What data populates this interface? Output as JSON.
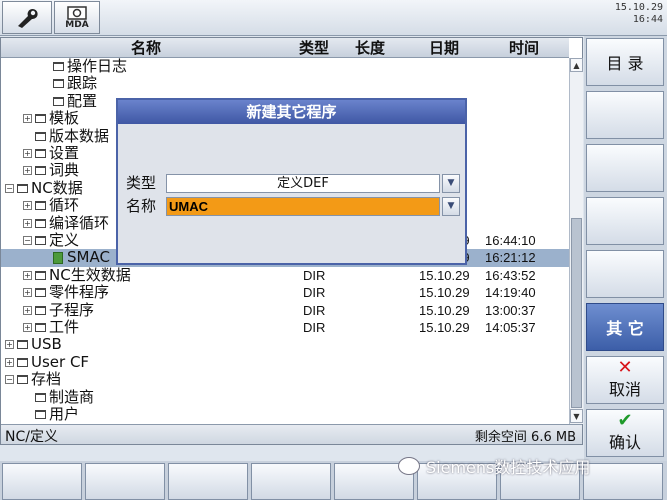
{
  "header": {
    "mda_label": "MDA",
    "date": "15.10.29",
    "time": "16:44"
  },
  "browser": {
    "columns": {
      "name": "名称",
      "type": "类型",
      "length": "长度",
      "date": "日期",
      "time": "时间"
    },
    "rows": [
      {
        "indent": 2,
        "exp": "",
        "icon": "folder",
        "name": "操作日志",
        "type": "",
        "date": "",
        "time": ""
      },
      {
        "indent": 2,
        "exp": "",
        "icon": "folder",
        "name": "跟踪",
        "type": "",
        "date": "",
        "time": ""
      },
      {
        "indent": 2,
        "exp": "",
        "icon": "folder",
        "name": "配置",
        "type": "",
        "date": "",
        "time": ""
      },
      {
        "indent": 1,
        "exp": "+",
        "icon": "folder",
        "name": "模板",
        "type": "",
        "date": "",
        "time": ""
      },
      {
        "indent": 1,
        "exp": "",
        "icon": "folder",
        "name": "版本数据",
        "type": "",
        "date": "",
        "time": ""
      },
      {
        "indent": 1,
        "exp": "+",
        "icon": "folder",
        "name": "设置",
        "type": "",
        "date": "",
        "time": ""
      },
      {
        "indent": 1,
        "exp": "+",
        "icon": "folder",
        "name": "词典",
        "type": "",
        "date": "",
        "time": ""
      },
      {
        "indent": 0,
        "exp": "-",
        "icon": "folder",
        "name": "NC数据",
        "type": "",
        "date": "",
        "time": ""
      },
      {
        "indent": 1,
        "exp": "+",
        "icon": "folder",
        "name": "循环",
        "type": "",
        "date": "",
        "time": ""
      },
      {
        "indent": 1,
        "exp": "+",
        "icon": "folder",
        "name": "编译循环",
        "type": "",
        "date": "",
        "time": ""
      },
      {
        "indent": 1,
        "exp": "-",
        "icon": "folder",
        "name": "定义",
        "type": "",
        "date": "15.10.29",
        "time": "16:44:10"
      },
      {
        "indent": 2,
        "exp": "",
        "icon": "file",
        "name": "SMAC",
        "type": "",
        "date": "15.10.29",
        "time": "16:21:12",
        "selected": true
      },
      {
        "indent": 1,
        "exp": "+",
        "icon": "folder",
        "name": "NC生效数据",
        "type": "DIR",
        "date": "15.10.29",
        "time": "16:43:52"
      },
      {
        "indent": 1,
        "exp": "+",
        "icon": "folder",
        "name": "零件程序",
        "type": "DIR",
        "date": "15.10.29",
        "time": "14:19:40"
      },
      {
        "indent": 1,
        "exp": "+",
        "icon": "folder",
        "name": "子程序",
        "type": "DIR",
        "date": "15.10.29",
        "time": "13:00:37"
      },
      {
        "indent": 1,
        "exp": "+",
        "icon": "folder",
        "name": "工件",
        "type": "DIR",
        "date": "15.10.29",
        "time": "14:05:37"
      },
      {
        "indent": 0,
        "exp": "+",
        "icon": "folder",
        "name": "USB",
        "type": "",
        "date": "",
        "time": ""
      },
      {
        "indent": 0,
        "exp": "+",
        "icon": "folder",
        "name": "User CF",
        "type": "",
        "date": "",
        "time": ""
      },
      {
        "indent": 0,
        "exp": "-",
        "icon": "folder",
        "name": "存档",
        "type": "",
        "date": "",
        "time": ""
      },
      {
        "indent": 1,
        "exp": "",
        "icon": "folder",
        "name": "制造商",
        "type": "",
        "date": "",
        "time": ""
      },
      {
        "indent": 1,
        "exp": "",
        "icon": "folder",
        "name": "用户",
        "type": "",
        "date": "",
        "time": ""
      }
    ],
    "status_path": "NC/定义",
    "free_space": "剩余空间 6.6 MB"
  },
  "dialog": {
    "title": "新建其它程序",
    "type_label": "类型",
    "type_value": "定义DEF",
    "name_label": "名称",
    "name_value": "UMAC"
  },
  "softkeys": {
    "directory": "目 录",
    "other": "其 它",
    "cancel": "取消",
    "confirm": "确认"
  },
  "watermark": "Siemens数控技术应用"
}
